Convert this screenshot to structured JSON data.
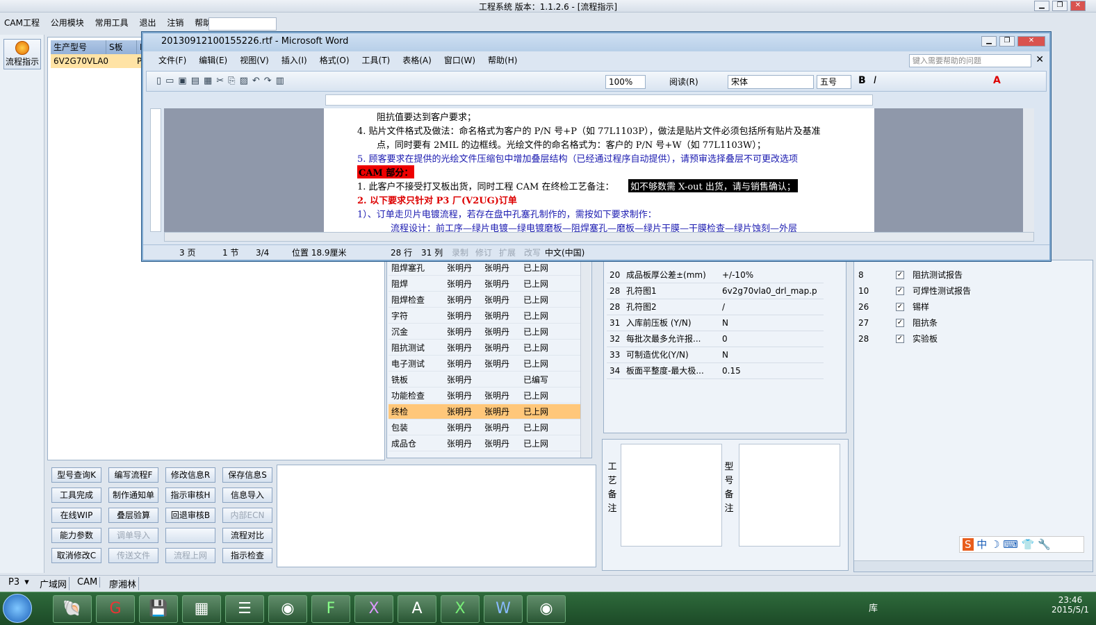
{
  "app": {
    "title": "工程系统   版本：1.1.2.6 - [流程指示]",
    "menus": [
      "CAM工程",
      "公用模块",
      "常用工具",
      "退出",
      "注销",
      "帮助"
    ]
  },
  "left": {
    "flow_btn": "流程指示"
  },
  "order": {
    "headers": [
      "生产型号",
      "S板",
      "P"
    ],
    "row": [
      "6V2G70VLA0",
      "",
      "P"
    ]
  },
  "steps": [
    {
      "name": "阻焊塞孔",
      "a": "张明丹",
      "b": "张明丹",
      "s": "已上网"
    },
    {
      "name": "阻焊",
      "a": "张明丹",
      "b": "张明丹",
      "s": "已上网"
    },
    {
      "name": "阻焊检查",
      "a": "张明丹",
      "b": "张明丹",
      "s": "已上网"
    },
    {
      "name": "字符",
      "a": "张明丹",
      "b": "张明丹",
      "s": "已上网"
    },
    {
      "name": "沉金",
      "a": "张明丹",
      "b": "张明丹",
      "s": "已上网"
    },
    {
      "name": "阻抗测试",
      "a": "张明丹",
      "b": "张明丹",
      "s": "已上网"
    },
    {
      "name": "电子测试",
      "a": "张明丹",
      "b": "张明丹",
      "s": "已上网"
    },
    {
      "name": "铣板",
      "a": "张明丹",
      "b": "",
      "s": "已编写"
    },
    {
      "name": "功能检查",
      "a": "张明丹",
      "b": "张明丹",
      "s": "已上网"
    },
    {
      "name": "终检",
      "a": "张明丹",
      "b": "张明丹",
      "s": "已上网"
    },
    {
      "name": "包装",
      "a": "张明丹",
      "b": "张明丹",
      "s": "已上网"
    },
    {
      "name": "成品仓",
      "a": "张明丹",
      "b": "张明丹",
      "s": "已上网"
    }
  ],
  "params": [
    {
      "n": "20",
      "k": "成品板厚公差±(mm)",
      "v": "+/-10%"
    },
    {
      "n": "28",
      "k": "孔符图1",
      "v": "6v2g70vla0_drl_map.p"
    },
    {
      "n": "28",
      "k": "孔符图2",
      "v": "/"
    },
    {
      "n": "31",
      "k": "入库前压板 (Y/N)",
      "v": "N"
    },
    {
      "n": "32",
      "k": "每批次最多允许报...",
      "v": "0"
    },
    {
      "n": "33",
      "k": "可制造优化(Y/N)",
      "v": "N"
    },
    {
      "n": "34",
      "k": "板面平整度-最大极...",
      "v": "0.15"
    }
  ],
  "checks": [
    {
      "n": "8",
      "k": "阻抗测试报告"
    },
    {
      "n": "10",
      "k": "可焊性测试报告"
    },
    {
      "n": "26",
      "k": "锡样"
    },
    {
      "n": "27",
      "k": "阻抗条"
    },
    {
      "n": "28",
      "k": "实验板"
    }
  ],
  "buttons": [
    "型号查询K",
    "编写流程F",
    "修改信息R",
    "保存信息S",
    "工具完成",
    "制作通知单",
    "指示审核H",
    "信息导入",
    "在线WIP",
    "叠层验算",
    "回退审核B",
    "内部ECN",
    "能力参数",
    "调单导入",
    "",
    "流程对比",
    "取消修改C",
    "传送文件",
    "流程上网",
    "指示检查"
  ],
  "remarks": {
    "left": "工艺备注",
    "right": "型号备注"
  },
  "bottom": {
    "combo": "P3",
    "tabs": [
      "广域网",
      "CAM",
      "廖湘林"
    ]
  },
  "tray": {
    "time": "23:46",
    "date": "2015/5/1",
    "lib": "库"
  },
  "word": {
    "title": "20130912100155226.rtf - Microsoft Word",
    "menus": [
      "文件(F)",
      "编辑(E)",
      "视图(V)",
      "插入(I)",
      "格式(O)",
      "工具(T)",
      "表格(A)",
      "窗口(W)",
      "帮助(H)"
    ],
    "help_placeholder": "键入需要帮助的问题",
    "zoom": "100%",
    "read": "阅读(R)",
    "font": "宋体",
    "size": "五号",
    "lines": [
      "阻抗值要达到客户要求；",
      "4.  贴片文件格式及做法：命名格式为客户的 P/N 号+P（如 77L1103P），做法是贴片文件必须包括所有贴片及基准",
      "点，同时要有 2MIL 的边框线。光绘文件的命名格式为：客户的 P/N 号+W（如 77L1103W）；",
      "5. 顾客要求在提供的光绘文件压缩包中增加叠层结构（已经通过程序自动提供），请预审选择叠层不可更改选项",
      "CAM 部分：",
      "1.  此客户不接受打叉板出货，同时工程 CAM 在终检工艺备注：",
      "如不够数需 X-out 出货，请与销售确认；",
      "2.  以下要求只针对 P3 厂(V2UG)订单",
      "1）、订单走贝片电镀流程，若存在盘中孔塞孔制作的，需按如下要求制作：",
      "流程设计：前工序—绿片电镀—绿电镀磨板—阻焊塞孔—磨板—绿片干膜—干膜检查—绿片蚀刻—外层"
    ],
    "status": [
      "3 页",
      "1 节",
      "3/4",
      "位置 18.9厘米",
      "28 行",
      "31 列",
      "录制",
      "修订",
      "扩展",
      "改写",
      "中文(中国)"
    ]
  }
}
